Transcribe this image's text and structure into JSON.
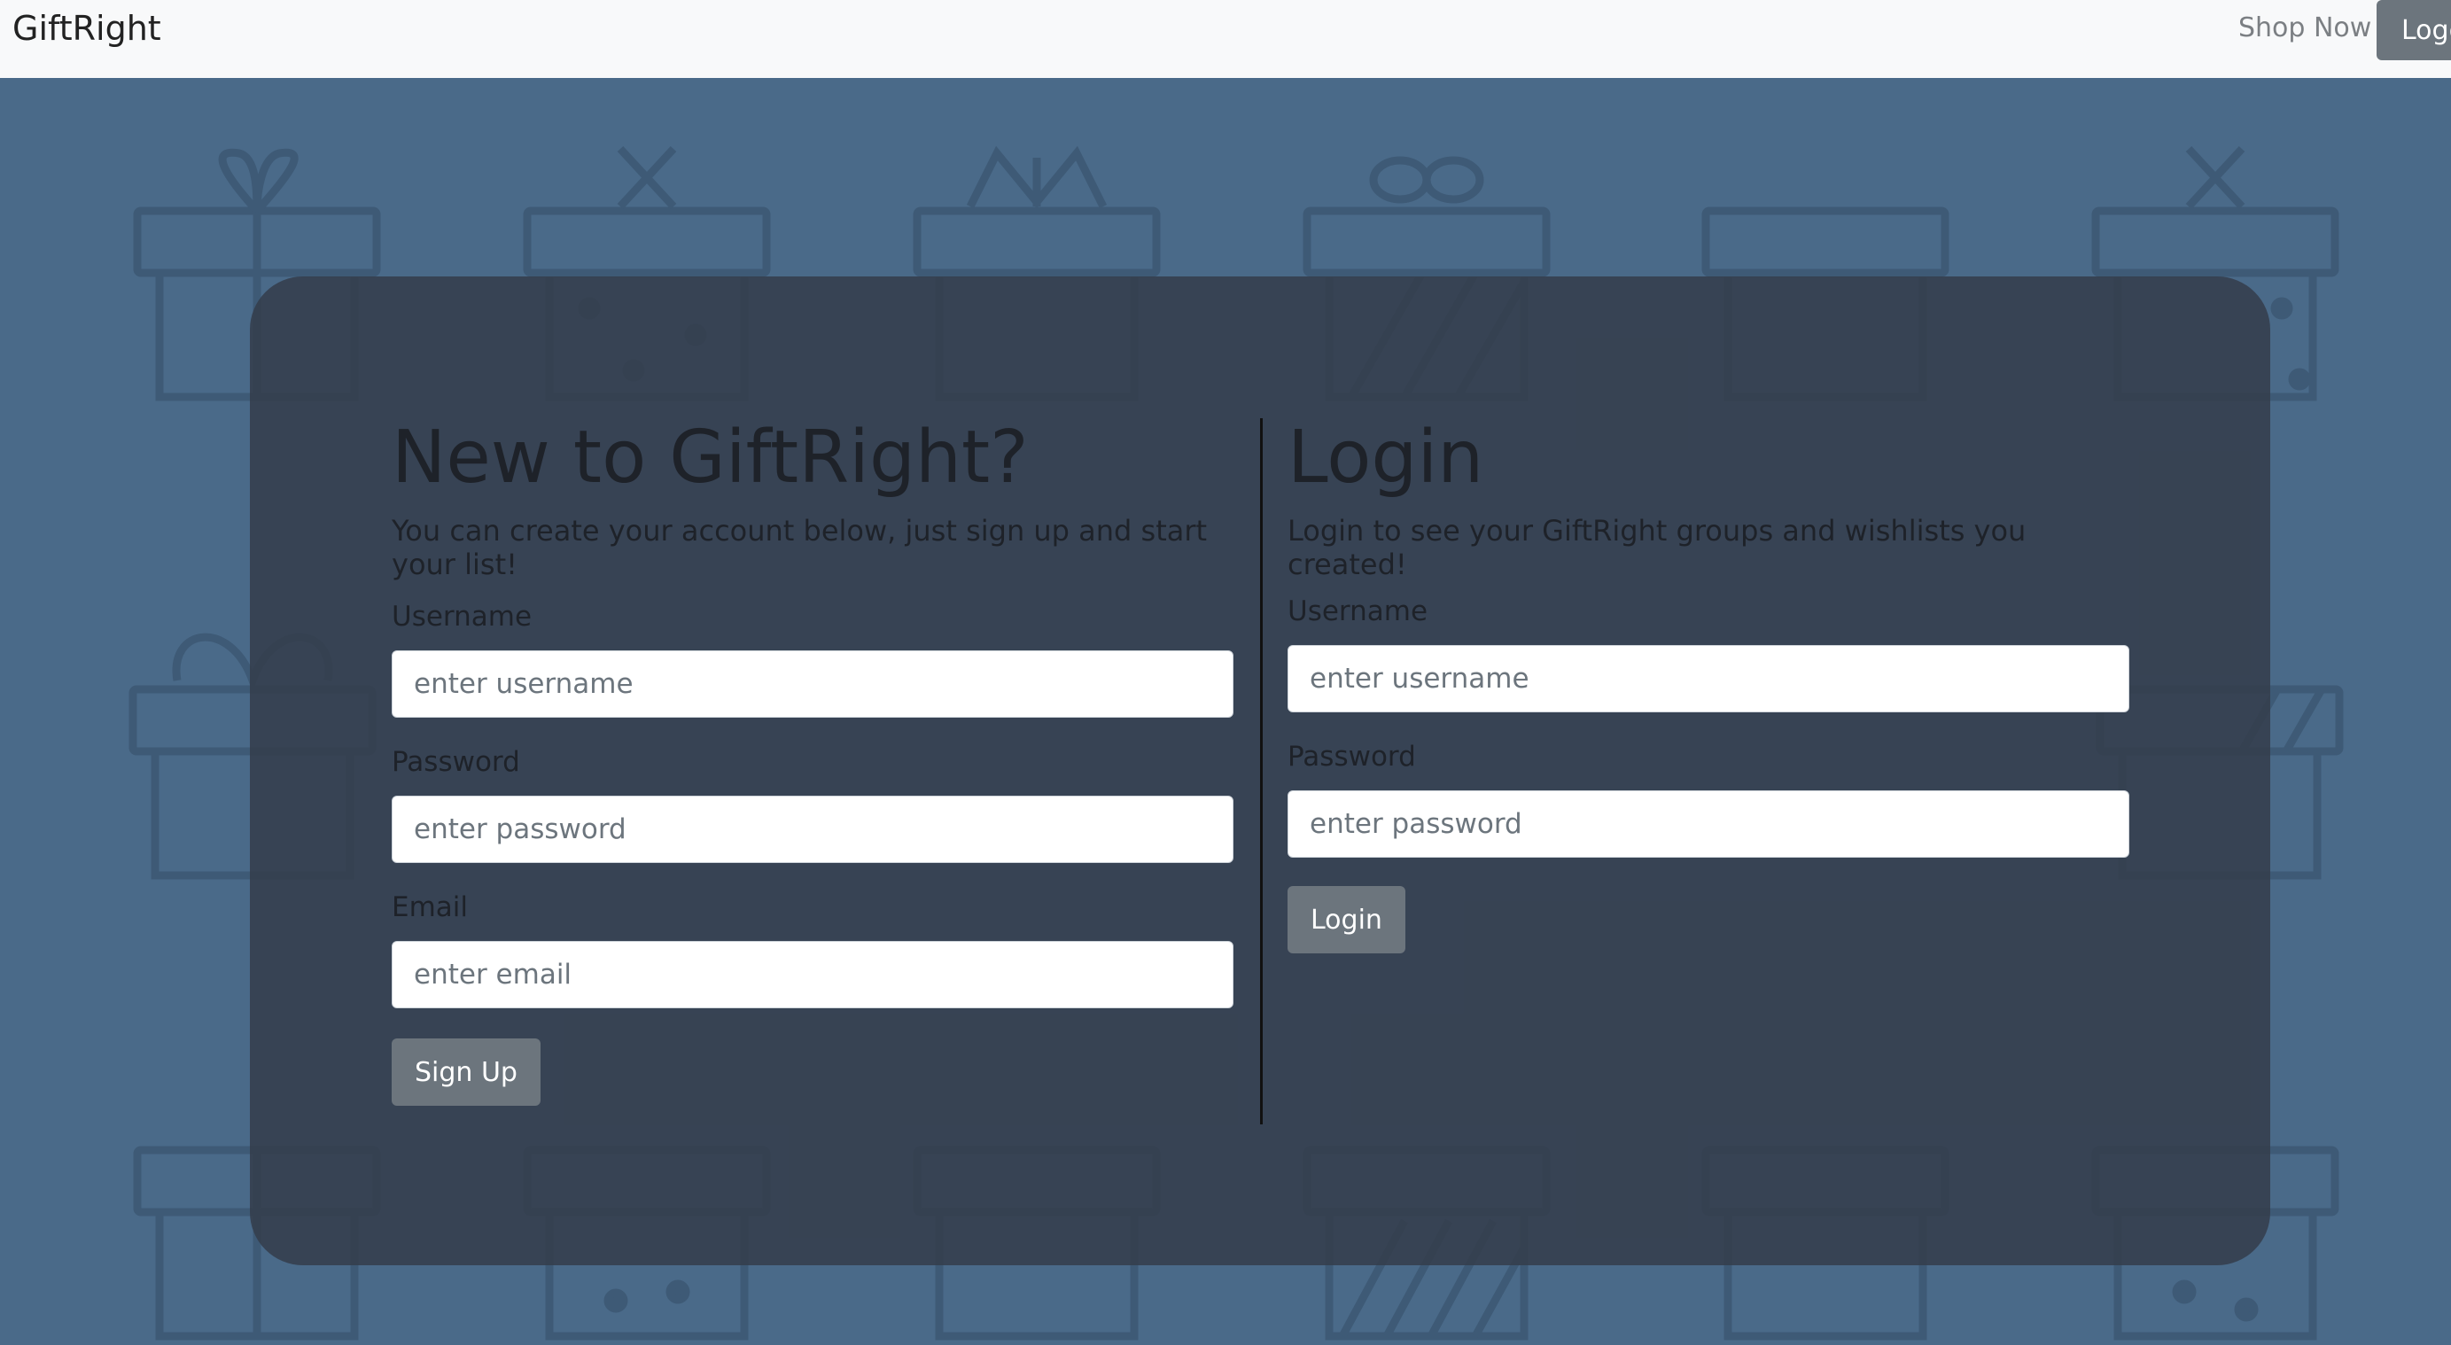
{
  "navbar": {
    "brand": "GiftRight",
    "shop_link": "Shop Now",
    "logout_label": "Logout"
  },
  "signup": {
    "heading": "New to GiftRight?",
    "subtext": "You can create your account below, just sign up and start your list!",
    "username_label": "Username",
    "username_placeholder": "enter username",
    "password_label": "Password",
    "password_placeholder": "enter password",
    "email_label": "Email",
    "email_placeholder": "enter email",
    "button_label": "Sign Up"
  },
  "login": {
    "heading": "Login",
    "subtext": "Login to see your GiftRight groups and wishlists you created!",
    "username_label": "Username",
    "username_placeholder": "enter username",
    "password_label": "Password",
    "password_placeholder": "enter password",
    "button_label": "Login"
  },
  "colors": {
    "background": "#4a6a89",
    "panel": "#343e4c",
    "button": "#6c757d",
    "navbar": "#f8f9fa"
  },
  "icons": {
    "background_pattern": "gift-box-icon"
  }
}
